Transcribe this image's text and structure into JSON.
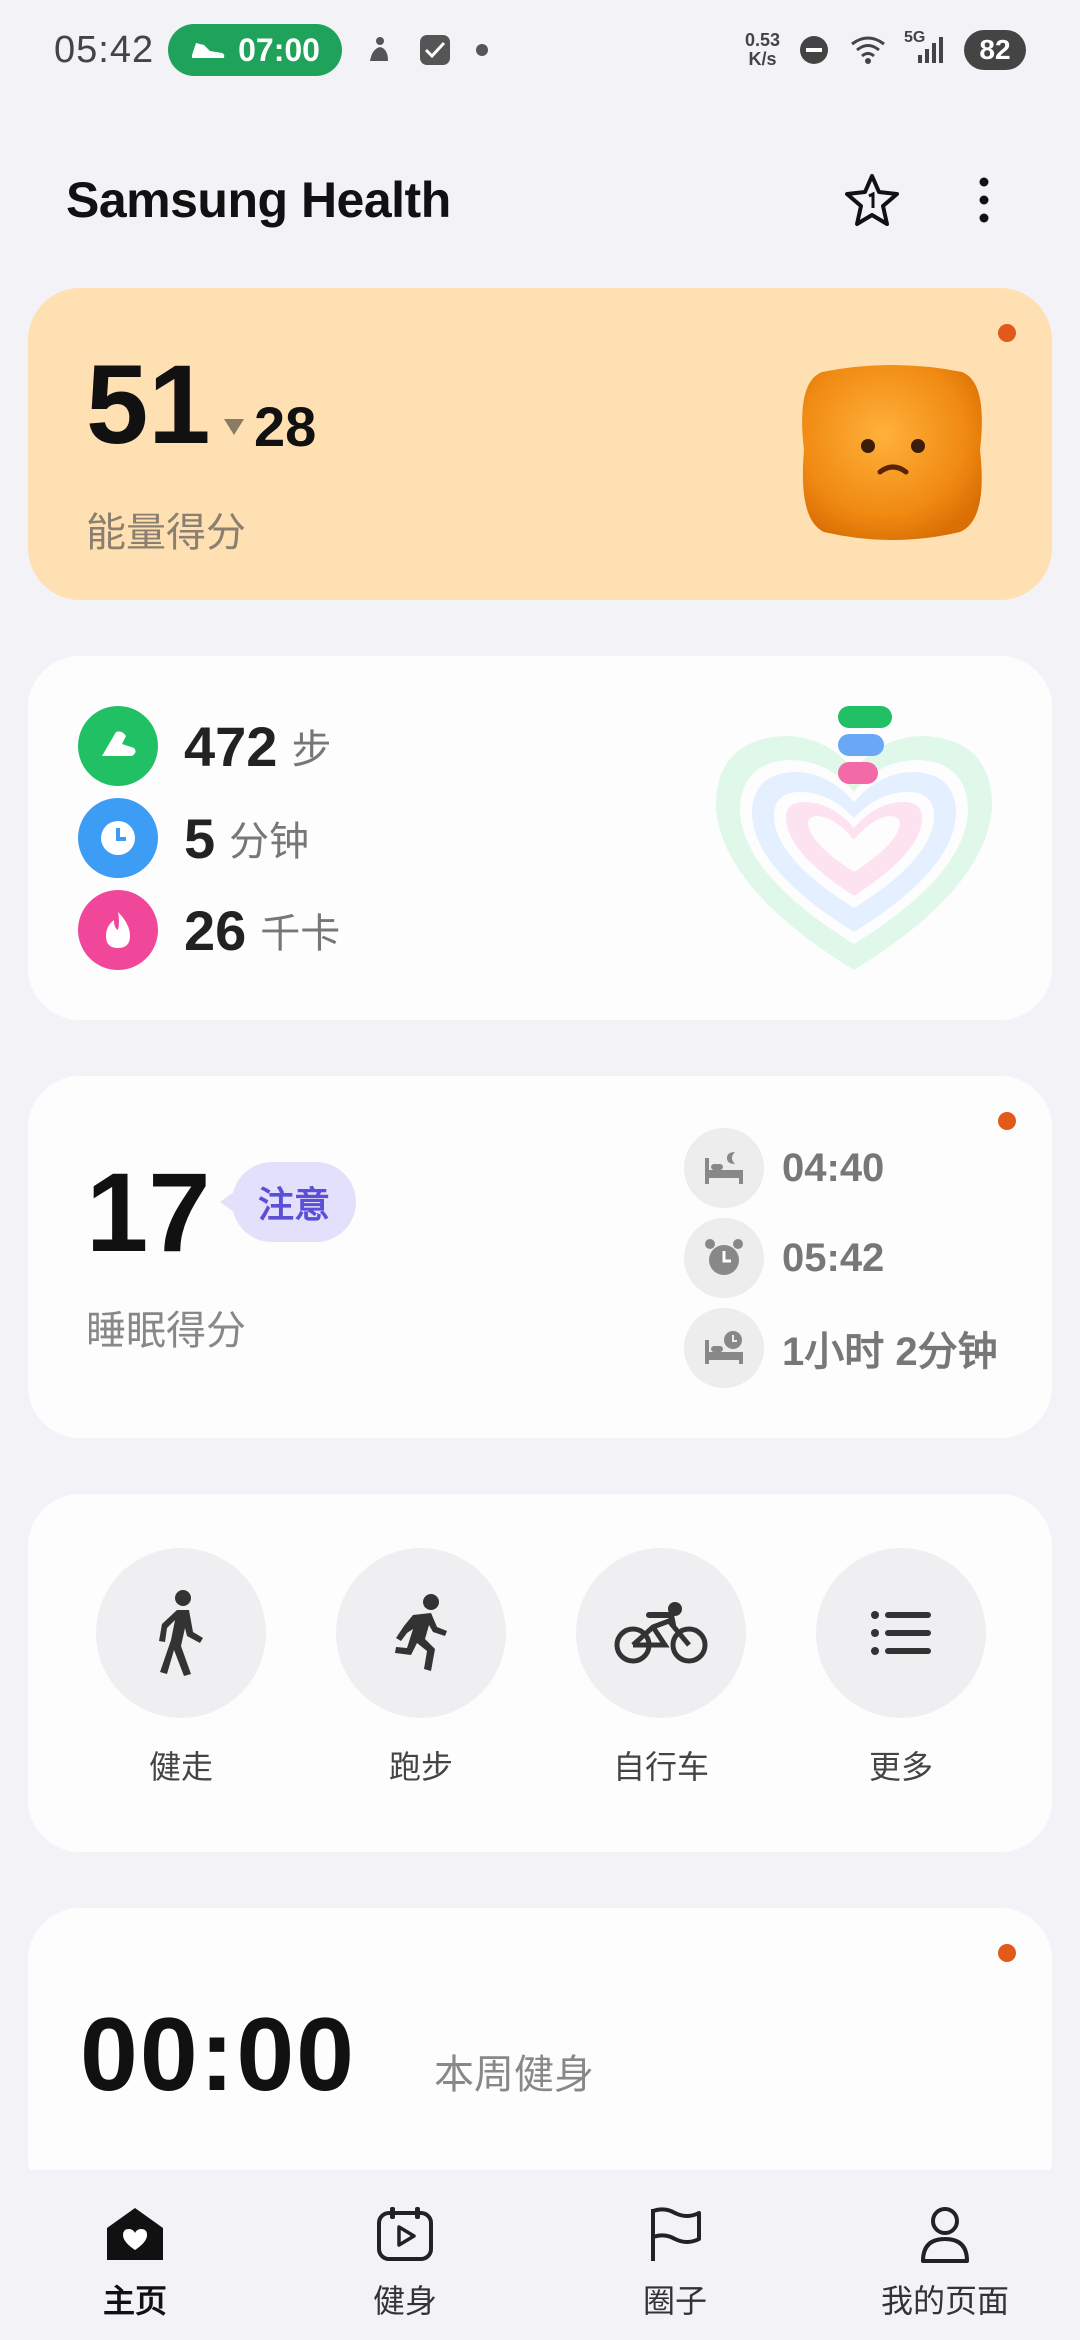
{
  "status_bar": {
    "time": "05:42",
    "alarm_time": "07:00",
    "net_speed_value": "0.53",
    "net_speed_unit": "K/s",
    "network": "5G",
    "battery": "82"
  },
  "header": {
    "title": "Samsung Health"
  },
  "energy": {
    "score": "51",
    "change": "28",
    "label": "能量得分"
  },
  "activity": {
    "steps_value": "472",
    "steps_unit": "步",
    "minutes_value": "5",
    "minutes_unit": "分钟",
    "calories_value": "26",
    "calories_unit": "千卡",
    "colors": {
      "steps": "#22c064",
      "minutes": "#3d9df5",
      "calories": "#f0479b"
    }
  },
  "sleep": {
    "score": "17",
    "badge": "注意",
    "label": "睡眠得分",
    "bed_time": "04:40",
    "wake_time": "05:42",
    "duration": "1小时 2分钟"
  },
  "quick_exercise": {
    "items": [
      {
        "label": "健走",
        "icon": "walking-icon"
      },
      {
        "label": "跑步",
        "icon": "running-icon"
      },
      {
        "label": "自行车",
        "icon": "cycling-icon"
      },
      {
        "label": "更多",
        "icon": "list-icon"
      }
    ]
  },
  "fitness": {
    "time": "00:00",
    "label": "本周健身"
  },
  "bottom_nav": {
    "items": [
      {
        "label": "主页",
        "icon": "home-heart-icon",
        "active": true
      },
      {
        "label": "健身",
        "icon": "fitness-play-icon",
        "active": false
      },
      {
        "label": "圈子",
        "icon": "flag-icon",
        "active": false
      },
      {
        "label": "我的页面",
        "icon": "person-icon",
        "active": false
      }
    ]
  }
}
